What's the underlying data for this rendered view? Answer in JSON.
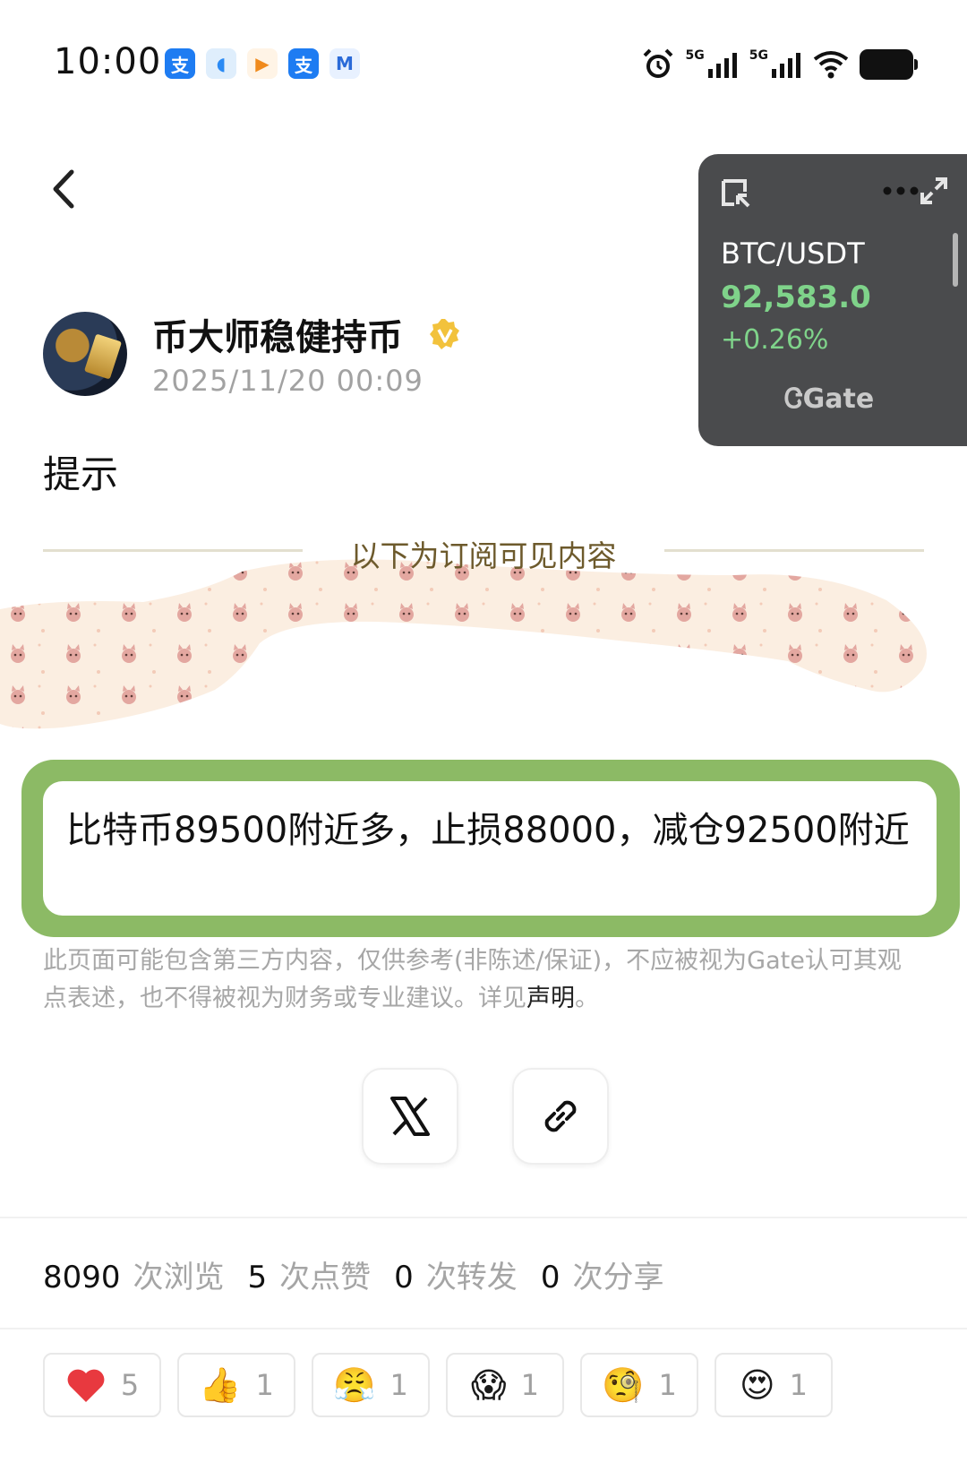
{
  "status_bar": {
    "time": "10:00",
    "notification_icons": [
      "alipay-icon",
      "notes-app-icon",
      "video-app-icon",
      "alipay-icon",
      "mail-app-icon"
    ],
    "network_labels": [
      "5G",
      "5G"
    ]
  },
  "ticker": {
    "pair": "BTC/USDT",
    "price": "92,583.0",
    "change": "+0.26%",
    "brand": "Gate",
    "color_up": "#7fd38a"
  },
  "post": {
    "author": "币大师稳健持币",
    "date": "2025/11/20 00:09",
    "title": "提示",
    "subscription_divider": "以下为订阅可见内容",
    "content": "比特币89500附近多，止损88000，减仓92500附近",
    "disclaimer": "此页面可能包含第三方内容，仅供参考(非陈述/保证)，不应被视为Gate认可其观点表述，也不得被视为财务或专业建议。详见",
    "disclaimer_link": "声明",
    "disclaimer_end": "。"
  },
  "share": {
    "buttons": [
      "x-icon",
      "link-icon"
    ]
  },
  "stats": {
    "views": "8090",
    "views_label": "次浏览",
    "likes": "5",
    "likes_label": "次点赞",
    "reposts": "0",
    "reposts_label": "次转发",
    "shares": "0",
    "shares_label": "次分享"
  },
  "reactions": [
    {
      "emoji": "❤️",
      "count": "5"
    },
    {
      "emoji": "👍",
      "count": "1"
    },
    {
      "emoji": "😤",
      "count": "1"
    },
    {
      "emoji": "😱",
      "count": "1"
    },
    {
      "emoji": "🧐",
      "count": "1"
    },
    {
      "emoji": "😍",
      "count": "1"
    }
  ],
  "colors": {
    "highlight_border": "#8cba65",
    "widget_bg": "#4a4b4d",
    "divider_text": "#6d5a2c"
  }
}
